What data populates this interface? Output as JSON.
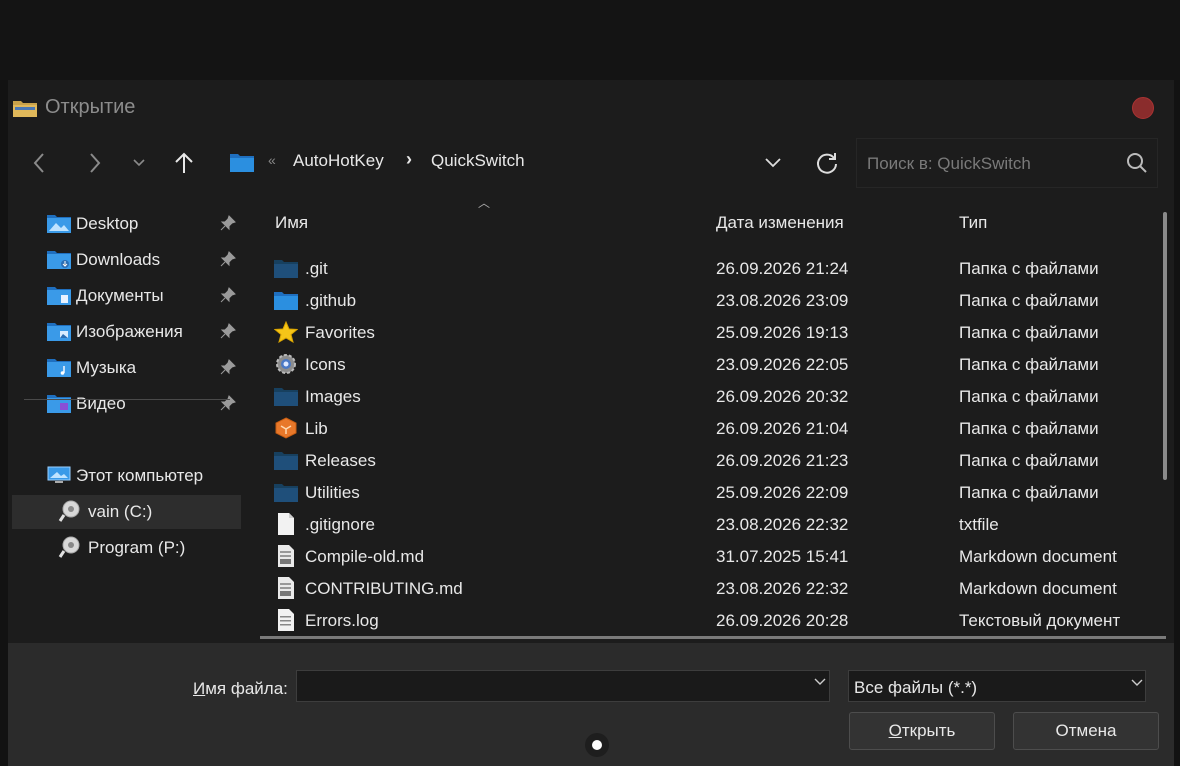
{
  "window": {
    "title": "Открытие"
  },
  "nav": {
    "back_icon": "chevron-left-icon",
    "forward_icon": "chevron-right-icon",
    "recent_icon": "chevron-down-icon",
    "up_icon": "arrow-up-icon"
  },
  "breadcrumb": {
    "overflow": "«",
    "items": [
      "AutoHotKey",
      "QuickSwitch"
    ],
    "separator": "›"
  },
  "search": {
    "placeholder": "Поиск в: QuickSwitch"
  },
  "sidebar": {
    "quick_access": [
      {
        "label": "Desktop",
        "icon": "desktop-folder-icon"
      },
      {
        "label": "Downloads",
        "icon": "downloads-folder-icon"
      },
      {
        "label": "Документы",
        "icon": "documents-folder-icon"
      },
      {
        "label": "Изображения",
        "icon": "pictures-folder-icon"
      },
      {
        "label": "Музыка",
        "icon": "music-folder-icon"
      },
      {
        "label": "Видео",
        "icon": "video-folder-icon"
      }
    ],
    "this_pc": "Этот компьютер",
    "drives": [
      {
        "label": "vain (C:)",
        "selected": true
      },
      {
        "label": "Program (P:)",
        "selected": false
      }
    ]
  },
  "columns": {
    "name": "Имя",
    "date": "Дата изменения",
    "type": "Тип"
  },
  "files": [
    {
      "name": ".git",
      "date": "26.09.2026 21:24",
      "type": "Папка с файлами",
      "icon": "folder-dark"
    },
    {
      "name": ".github",
      "date": "23.08.2026 23:09",
      "type": "Папка с файлами",
      "icon": "folder-blue"
    },
    {
      "name": "Favorites",
      "date": "25.09.2026 19:13",
      "type": "Папка с файлами",
      "icon": "star"
    },
    {
      "name": "Icons",
      "date": "23.09.2026 22:05",
      "type": "Папка с файлами",
      "icon": "gear"
    },
    {
      "name": "Images",
      "date": "26.09.2026 20:32",
      "type": "Папка с файлами",
      "icon": "folder-dark"
    },
    {
      "name": "Lib",
      "date": "26.09.2026 21:04",
      "type": "Папка с файлами",
      "icon": "box"
    },
    {
      "name": "Releases",
      "date": "26.09.2026 21:23",
      "type": "Папка с файлами",
      "icon": "folder-dark"
    },
    {
      "name": "Utilities",
      "date": "25.09.2026 22:09",
      "type": "Папка с файлами",
      "icon": "folder-dark"
    },
    {
      "name": ".gitignore",
      "date": "23.08.2026 22:32",
      "type": "txtfile",
      "icon": "file-blank"
    },
    {
      "name": "Compile-old.md",
      "date": "31.07.2025 15:41",
      "type": "Markdown document",
      "icon": "file-md"
    },
    {
      "name": "CONTRIBUTING.md",
      "date": "23.08.2026 22:32",
      "type": "Markdown document",
      "icon": "file-md"
    },
    {
      "name": "Errors.log",
      "date": "26.09.2026 20:28",
      "type": "Текстовый документ",
      "icon": "file-text"
    }
  ],
  "footer": {
    "filename_label_access": "И",
    "filename_label_rest": "мя файла:",
    "filename_value": "",
    "filetype": "Все файлы (*.*)",
    "open_access": "О",
    "open_rest": "ткрыть",
    "cancel": "Отмена"
  },
  "colors": {
    "accent": "#2b8fe0",
    "folder_dark": "#1f4f7a",
    "close": "#8a2c2c"
  }
}
